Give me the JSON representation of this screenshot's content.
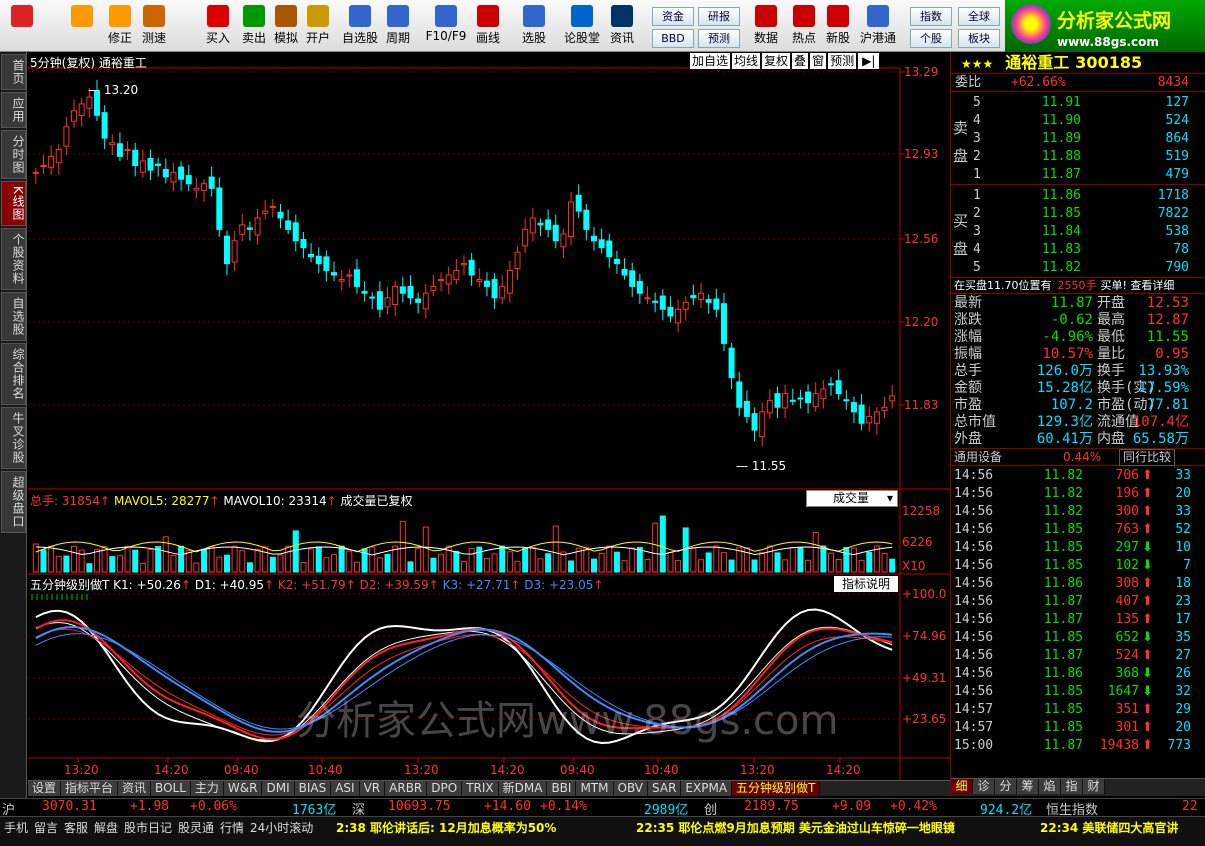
{
  "toolbar": {
    "buttons": [
      {
        "label": "",
        "icon": "app-grid-icon"
      },
      {
        "label": "",
        "icon": "back-arrow-icon"
      },
      {
        "label": "修正",
        "icon": "up-down-arrow-icon"
      },
      {
        "label": "测速",
        "icon": "clock-icon"
      },
      {
        "label": "买入",
        "icon": "buy-icon"
      },
      {
        "label": "卖出",
        "icon": "sell-icon"
      },
      {
        "label": "模拟",
        "icon": "hammer-icon"
      },
      {
        "label": "开户",
        "icon": "lock-icon"
      },
      {
        "label": "自选股",
        "icon": "star-icon"
      },
      {
        "label": "周期",
        "icon": "period-icon"
      },
      {
        "label": "F10/F9",
        "icon": "f10-icon"
      },
      {
        "label": "画线",
        "icon": "pen-icon"
      },
      {
        "label": "选股",
        "icon": "select-icon"
      },
      {
        "label": "论股堂",
        "icon": "forum-icon"
      },
      {
        "label": "资讯",
        "icon": "news-icon"
      },
      {
        "label": "数据",
        "icon": "pe-icon"
      },
      {
        "label": "热点",
        "icon": "hot-icon"
      },
      {
        "label": "新股",
        "icon": "new-stock-icon"
      },
      {
        "label": "沪港通",
        "icon": "hk-connect-icon"
      }
    ],
    "small": [
      "资金",
      "BBD",
      "研报",
      "预测",
      "指数",
      "个股",
      "全球",
      "板块"
    ],
    "brand": "分析家公式网",
    "brand_url": "www.88gs.com"
  },
  "sidebar": [
    "首页",
    "应用",
    "分时图",
    "K线图",
    "个股资料",
    "自选股",
    "综合排名",
    "牛叉诊股",
    "超级盘口"
  ],
  "chart": {
    "header_left": "5分钟(复权)  通裕重工",
    "header_right": [
      "加自选",
      "均线",
      "复权",
      "叠",
      "窗",
      "预测"
    ],
    "price_axis": [
      "13.29",
      "12.93",
      "12.56",
      "12.20",
      "11.83"
    ],
    "high_label": "13.20",
    "low_label": "11.55",
    "vol_header": {
      "total": "总手: 31854",
      "ma5": "MAVOL5: 28277",
      "ma10": "MAVOL10: 23314",
      "note": "成交量已复权",
      "selector": "成交量"
    },
    "vol_axis": [
      "12258",
      "6226",
      "X10"
    ],
    "ind_header": {
      "name": "五分钟级别做T",
      "k1": "K1: +50.26",
      "d1": "D1: +40.95",
      "k2": "K2: +51.79",
      "d2": "D2: +39.59",
      "k3": "K3: +27.71",
      "d3": "D3: +23.05",
      "help": "指标说明"
    },
    "ind_axis": [
      "+100.0",
      "+74.96",
      "+49.31",
      "+23.65"
    ],
    "time_axis": [
      "13:20",
      "14:20",
      "09:40",
      "10:40",
      "13:20",
      "14:20",
      "09:40",
      "10:40",
      "13:20",
      "14:20"
    ],
    "watermark": "分析家公式网www.88gs.com",
    "colors": {
      "up": "#ff3030",
      "down": "#00ffff"
    }
  },
  "bottom_tabs": [
    "设置",
    "指标平台",
    "资讯",
    "BOLL",
    "主力",
    "W&R",
    "DMI",
    "BIAS",
    "ASI",
    "VR",
    "ARBR",
    "DPO",
    "TRIX",
    "新DMA",
    "BBI",
    "MTM",
    "OBV",
    "SAR",
    "EXPMA",
    "五分钟级别做T"
  ],
  "right": {
    "stars": "★★★",
    "name": "通裕重工",
    "code": "300185",
    "wb_label": "委比",
    "wb": "+62.66%",
    "wc": "8434",
    "sell_label": "卖盘",
    "buy_label": "买盘",
    "sell": [
      [
        "5",
        "11.91",
        "127"
      ],
      [
        "4",
        "11.90",
        "524"
      ],
      [
        "3",
        "11.89",
        "864"
      ],
      [
        "2",
        "11.88",
        "519"
      ],
      [
        "1",
        "11.87",
        "479"
      ]
    ],
    "buy": [
      [
        "1",
        "11.86",
        "1718"
      ],
      [
        "2",
        "11.85",
        "7822"
      ],
      [
        "3",
        "11.84",
        "538"
      ],
      [
        "4",
        "11.83",
        "78"
      ],
      [
        "5",
        "11.82",
        "790"
      ]
    ],
    "notice": "在买盘11.70位置有",
    "notice_vol": "2550手",
    "notice_tail": "买单! 查看详细",
    "stats": [
      [
        "最新",
        "11.87",
        "开盘",
        "12.53"
      ],
      [
        "涨跌",
        "-0.62",
        "最高",
        "12.87"
      ],
      [
        "涨幅",
        "-4.96%",
        "最低",
        "11.55"
      ],
      [
        "振幅",
        "10.57%",
        "量比",
        "0.95"
      ],
      [
        "总手",
        "126.0万",
        "换手",
        "13.93%"
      ],
      [
        "金额",
        "15.28亿",
        "换手(实)",
        "17.59%"
      ],
      [
        "市盈",
        "107.2",
        "市盈(动)",
        "77.81"
      ],
      [
        "总市值",
        "129.3亿",
        "流通值",
        "107.4亿"
      ],
      [
        "外盘",
        "60.41万",
        "内盘",
        "65.58万"
      ]
    ],
    "industry": "通用设备",
    "industry_pct": "0.44%",
    "compare": "同行比较",
    "ticks": [
      [
        "14:56",
        "11.82",
        "706",
        "33"
      ],
      [
        "14:56",
        "11.82",
        "196",
        "20"
      ],
      [
        "14:56",
        "11.82",
        "300",
        "33"
      ],
      [
        "14:56",
        "11.85",
        "763",
        "52"
      ],
      [
        "14:56",
        "11.85",
        "297",
        "10"
      ],
      [
        "14:56",
        "11.85",
        "102",
        "7"
      ],
      [
        "14:56",
        "11.86",
        "308",
        "18"
      ],
      [
        "14:56",
        "11.87",
        "407",
        "23"
      ],
      [
        "14:56",
        "11.87",
        "135",
        "17"
      ],
      [
        "14:56",
        "11.85",
        "652",
        "35"
      ],
      [
        "14:56",
        "11.87",
        "524",
        "27"
      ],
      [
        "14:56",
        "11.86",
        "368",
        "26"
      ],
      [
        "14:56",
        "11.85",
        "1647",
        "32"
      ],
      [
        "14:57",
        "11.85",
        "351",
        "29"
      ],
      [
        "14:57",
        "11.85",
        "301",
        "20"
      ],
      [
        "15:00",
        "11.87",
        "19438",
        "773"
      ]
    ],
    "tabs": [
      "细",
      "诊",
      "分",
      "筹",
      "焰",
      "指",
      "财"
    ]
  },
  "status": {
    "sh": "沪",
    "sh_val": "3070.31",
    "sh_chg": "+1.98",
    "sh_pct": "+0.06%",
    "sh_amt": "1763亿",
    "sz": "深",
    "sz_val": "10693.75",
    "sz_chg": "+14.60",
    "sz_pct": "+0.14%",
    "sz_amt": "2989亿",
    "cy": "创",
    "cy_val": "2189.75",
    "cy_chg": "+9.09",
    "cy_pct": "+0.42%",
    "hs_amt": "924.2亿",
    "hs": "恒生指数",
    "hs_val": "22"
  },
  "status2": {
    "items": [
      "手机",
      "留言",
      "客服",
      "解盘",
      "股市日记",
      "股灵通",
      "行情",
      "24小时滚动"
    ],
    "news1": "2:38 耶伦讲话后: 12月加息概率为50%",
    "news2": "22:35 耶伦点燃9月加息预期 美元金油过山车惊碎一地眼镜",
    "news3": "22:34 美联储四大高官讲"
  }
}
